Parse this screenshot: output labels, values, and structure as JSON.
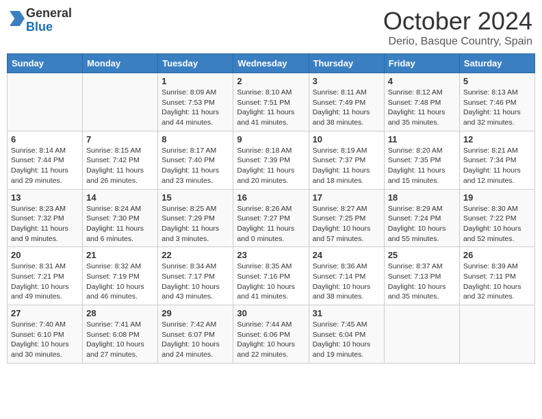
{
  "logo": {
    "line1": "General",
    "line2": "Blue"
  },
  "title": "October 2024",
  "location": "Derio, Basque Country, Spain",
  "days_header": [
    "Sunday",
    "Monday",
    "Tuesday",
    "Wednesday",
    "Thursday",
    "Friday",
    "Saturday"
  ],
  "weeks": [
    [
      {
        "day": "",
        "sunrise": "",
        "sunset": "",
        "daylight": ""
      },
      {
        "day": "",
        "sunrise": "",
        "sunset": "",
        "daylight": ""
      },
      {
        "day": "1",
        "sunrise": "Sunrise: 8:09 AM",
        "sunset": "Sunset: 7:53 PM",
        "daylight": "Daylight: 11 hours and 44 minutes."
      },
      {
        "day": "2",
        "sunrise": "Sunrise: 8:10 AM",
        "sunset": "Sunset: 7:51 PM",
        "daylight": "Daylight: 11 hours and 41 minutes."
      },
      {
        "day": "3",
        "sunrise": "Sunrise: 8:11 AM",
        "sunset": "Sunset: 7:49 PM",
        "daylight": "Daylight: 11 hours and 38 minutes."
      },
      {
        "day": "4",
        "sunrise": "Sunrise: 8:12 AM",
        "sunset": "Sunset: 7:48 PM",
        "daylight": "Daylight: 11 hours and 35 minutes."
      },
      {
        "day": "5",
        "sunrise": "Sunrise: 8:13 AM",
        "sunset": "Sunset: 7:46 PM",
        "daylight": "Daylight: 11 hours and 32 minutes."
      }
    ],
    [
      {
        "day": "6",
        "sunrise": "Sunrise: 8:14 AM",
        "sunset": "Sunset: 7:44 PM",
        "daylight": "Daylight: 11 hours and 29 minutes."
      },
      {
        "day": "7",
        "sunrise": "Sunrise: 8:15 AM",
        "sunset": "Sunset: 7:42 PM",
        "daylight": "Daylight: 11 hours and 26 minutes."
      },
      {
        "day": "8",
        "sunrise": "Sunrise: 8:17 AM",
        "sunset": "Sunset: 7:40 PM",
        "daylight": "Daylight: 11 hours and 23 minutes."
      },
      {
        "day": "9",
        "sunrise": "Sunrise: 8:18 AM",
        "sunset": "Sunset: 7:39 PM",
        "daylight": "Daylight: 11 hours and 20 minutes."
      },
      {
        "day": "10",
        "sunrise": "Sunrise: 8:19 AM",
        "sunset": "Sunset: 7:37 PM",
        "daylight": "Daylight: 11 hours and 18 minutes."
      },
      {
        "day": "11",
        "sunrise": "Sunrise: 8:20 AM",
        "sunset": "Sunset: 7:35 PM",
        "daylight": "Daylight: 11 hours and 15 minutes."
      },
      {
        "day": "12",
        "sunrise": "Sunrise: 8:21 AM",
        "sunset": "Sunset: 7:34 PM",
        "daylight": "Daylight: 11 hours and 12 minutes."
      }
    ],
    [
      {
        "day": "13",
        "sunrise": "Sunrise: 8:23 AM",
        "sunset": "Sunset: 7:32 PM",
        "daylight": "Daylight: 11 hours and 9 minutes."
      },
      {
        "day": "14",
        "sunrise": "Sunrise: 8:24 AM",
        "sunset": "Sunset: 7:30 PM",
        "daylight": "Daylight: 11 hours and 6 minutes."
      },
      {
        "day": "15",
        "sunrise": "Sunrise: 8:25 AM",
        "sunset": "Sunset: 7:29 PM",
        "daylight": "Daylight: 11 hours and 3 minutes."
      },
      {
        "day": "16",
        "sunrise": "Sunrise: 8:26 AM",
        "sunset": "Sunset: 7:27 PM",
        "daylight": "Daylight: 11 hours and 0 minutes."
      },
      {
        "day": "17",
        "sunrise": "Sunrise: 8:27 AM",
        "sunset": "Sunset: 7:25 PM",
        "daylight": "Daylight: 10 hours and 57 minutes."
      },
      {
        "day": "18",
        "sunrise": "Sunrise: 8:29 AM",
        "sunset": "Sunset: 7:24 PM",
        "daylight": "Daylight: 10 hours and 55 minutes."
      },
      {
        "day": "19",
        "sunrise": "Sunrise: 8:30 AM",
        "sunset": "Sunset: 7:22 PM",
        "daylight": "Daylight: 10 hours and 52 minutes."
      }
    ],
    [
      {
        "day": "20",
        "sunrise": "Sunrise: 8:31 AM",
        "sunset": "Sunset: 7:21 PM",
        "daylight": "Daylight: 10 hours and 49 minutes."
      },
      {
        "day": "21",
        "sunrise": "Sunrise: 8:32 AM",
        "sunset": "Sunset: 7:19 PM",
        "daylight": "Daylight: 10 hours and 46 minutes."
      },
      {
        "day": "22",
        "sunrise": "Sunrise: 8:34 AM",
        "sunset": "Sunset: 7:17 PM",
        "daylight": "Daylight: 10 hours and 43 minutes."
      },
      {
        "day": "23",
        "sunrise": "Sunrise: 8:35 AM",
        "sunset": "Sunset: 7:16 PM",
        "daylight": "Daylight: 10 hours and 41 minutes."
      },
      {
        "day": "24",
        "sunrise": "Sunrise: 8:36 AM",
        "sunset": "Sunset: 7:14 PM",
        "daylight": "Daylight: 10 hours and 38 minutes."
      },
      {
        "day": "25",
        "sunrise": "Sunrise: 8:37 AM",
        "sunset": "Sunset: 7:13 PM",
        "daylight": "Daylight: 10 hours and 35 minutes."
      },
      {
        "day": "26",
        "sunrise": "Sunrise: 8:39 AM",
        "sunset": "Sunset: 7:11 PM",
        "daylight": "Daylight: 10 hours and 32 minutes."
      }
    ],
    [
      {
        "day": "27",
        "sunrise": "Sunrise: 7:40 AM",
        "sunset": "Sunset: 6:10 PM",
        "daylight": "Daylight: 10 hours and 30 minutes."
      },
      {
        "day": "28",
        "sunrise": "Sunrise: 7:41 AM",
        "sunset": "Sunset: 6:08 PM",
        "daylight": "Daylight: 10 hours and 27 minutes."
      },
      {
        "day": "29",
        "sunrise": "Sunrise: 7:42 AM",
        "sunset": "Sunset: 6:07 PM",
        "daylight": "Daylight: 10 hours and 24 minutes."
      },
      {
        "day": "30",
        "sunrise": "Sunrise: 7:44 AM",
        "sunset": "Sunset: 6:06 PM",
        "daylight": "Daylight: 10 hours and 22 minutes."
      },
      {
        "day": "31",
        "sunrise": "Sunrise: 7:45 AM",
        "sunset": "Sunset: 6:04 PM",
        "daylight": "Daylight: 10 hours and 19 minutes."
      },
      {
        "day": "",
        "sunrise": "",
        "sunset": "",
        "daylight": ""
      },
      {
        "day": "",
        "sunrise": "",
        "sunset": "",
        "daylight": ""
      }
    ]
  ]
}
